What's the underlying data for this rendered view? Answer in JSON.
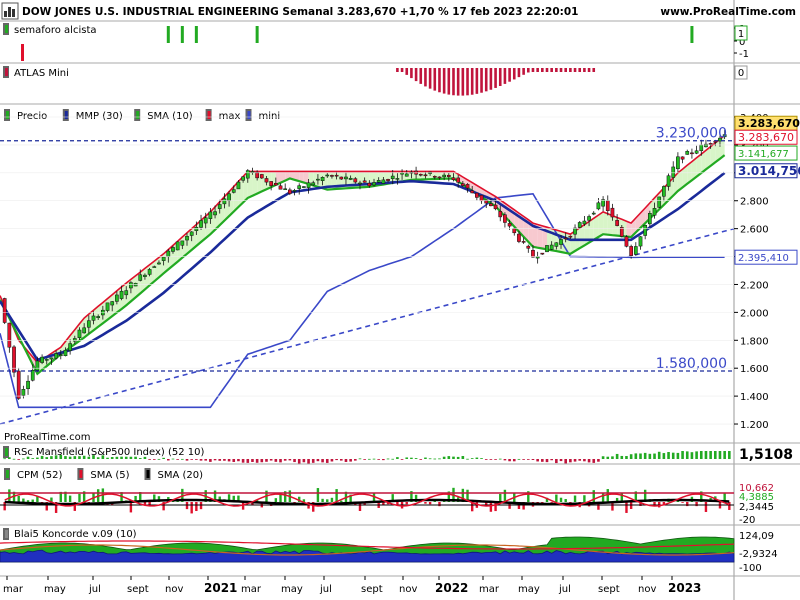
{
  "header": {
    "title": "DOW JONES U.S. INDUSTRIAL ENGINEERING Semanal 3.283,670 +1,70 % 17 feb 2023 22:20:01",
    "site": "www.ProRealTime.com"
  },
  "panels": {
    "semaforo": {
      "legend": "semaforo alcista",
      "ticks": [
        "1",
        "0",
        "-1"
      ],
      "current": "1",
      "color": "#22aa22",
      "signals": [
        "2020-11-02",
        "2020-11-23",
        "2020-12-14",
        "2021-03-15",
        "2022-12-26"
      ]
    },
    "atlas": {
      "legend": "ATLAS Mini",
      "ticks": [
        "0"
      ],
      "color": "#c0143c"
    },
    "price": {
      "legend": [
        "Precio",
        "MMP (30)",
        "SMA (10)",
        "max",
        "mini"
      ],
      "legend_colors": [
        "#22aa22",
        "#1a2a9a",
        "#22aa22",
        "#e0102c",
        "#3a48c8"
      ],
      "levels": {
        "upper": "3.230,000",
        "lower": "1.580,000"
      },
      "badges": {
        "last": "3.283,670",
        "max": "3.283,670",
        "sma": "3.141,677",
        "mmp": "3.014,756",
        "mini": "2.395,410"
      },
      "watermark": "ProRealTime.com"
    },
    "mansfield": {
      "legend": "RSc Mansfield (S&P500 Index) (52 10)",
      "value": "1,5108"
    },
    "cpm": {
      "legend": [
        "CPM (52)",
        "SMA (5)",
        "SMA (20)"
      ],
      "legend_colors": [
        "#22aa22",
        "#e0102c",
        "#000000"
      ],
      "ticks": [
        "10,662",
        "4,3885",
        "2,3445",
        "-20"
      ]
    },
    "koncorde": {
      "legend": "Blai5 Koncorde v.09 (10)",
      "ticks": [
        "124,09",
        "-2,9324",
        "-100"
      ]
    }
  },
  "x_axis": {
    "labels": [
      "mar",
      "may",
      "jul",
      "sept",
      "nov",
      "2021",
      "mar",
      "may",
      "jul",
      "sept",
      "nov",
      "2022",
      "mar",
      "may",
      "jul",
      "sept",
      "nov",
      "2023"
    ]
  },
  "chart_data": {
    "type": "line",
    "title": "DOW JONES U.S. INDUSTRIAL ENGINEERING",
    "xlabel": "",
    "ylabel": "",
    "ylim": [
      1150,
      3400
    ],
    "y_ticks": [
      "3.400",
      "3.200",
      "3.000",
      "2.800",
      "2.600",
      "2.400",
      "2.200",
      "2.000",
      "1.800",
      "1.600",
      "1.400",
      "1.200"
    ],
    "price_dates": [
      "2020-02-24",
      "2020-03-23",
      "2020-04-20",
      "2020-05-25",
      "2020-06-29",
      "2020-08-31",
      "2020-10-26",
      "2021-01-04",
      "2021-03-01",
      "2021-05-03",
      "2021-06-28",
      "2021-08-30",
      "2021-11-01",
      "2022-01-03",
      "2022-03-07",
      "2022-05-02",
      "2022-06-27",
      "2022-08-15",
      "2022-09-26",
      "2022-12-05",
      "2023-02-17"
    ],
    "price_values": [
      2100,
      1400,
      1650,
      1700,
      1900,
      2170,
      2400,
      2700,
      3010,
      2860,
      2980,
      2920,
      3010,
      2960,
      2730,
      2400,
      2560,
      2800,
      2420,
      3100,
      3283.67
    ],
    "series": [
      {
        "name": "max",
        "color": "#e0102c",
        "dates": [
          "2020-02-24",
          "2020-03-23",
          "2020-04-20",
          "2020-05-25",
          "2020-06-29",
          "2020-08-31",
          "2020-10-26",
          "2021-01-04",
          "2021-03-01",
          "2021-05-03",
          "2021-06-28",
          "2021-08-30",
          "2021-11-01",
          "2022-01-03",
          "2022-03-07",
          "2022-05-02",
          "2022-06-27",
          "2022-08-15",
          "2022-09-26",
          "2022-12-05",
          "2023-02-17"
        ],
        "values": [
          2120,
          1800,
          1640,
          1750,
          1960,
          2210,
          2420,
          2720,
          3010,
          3010,
          3010,
          3010,
          3010,
          3010,
          2830,
          2640,
          2560,
          2720,
          2640,
          3000,
          3283.67
        ]
      },
      {
        "name": "mini",
        "color": "#3a48c8",
        "dates": [
          "2020-02-24",
          "2020-03-23",
          "2020-06-29",
          "2020-10-26",
          "2021-01-04",
          "2021-03-01",
          "2021-05-03",
          "2021-06-28",
          "2021-08-30",
          "2021-11-01",
          "2022-01-03",
          "2022-03-07",
          "2022-05-02",
          "2022-06-27",
          "2022-09-26",
          "2023-02-17"
        ],
        "values": [
          1850,
          1320,
          1320,
          1320,
          1320,
          1700,
          1800,
          2150,
          2300,
          2400,
          2600,
          2820,
          2850,
          2400,
          2395,
          2395.41
        ]
      },
      {
        "name": "SMA (10)",
        "color": "#22aa22",
        "dates": [
          "2020-02-24",
          "2020-04-20",
          "2020-05-25",
          "2020-06-29",
          "2020-08-31",
          "2020-10-26",
          "2021-01-04",
          "2021-03-01",
          "2021-05-03",
          "2021-06-28",
          "2021-08-30",
          "2021-11-01",
          "2022-01-03",
          "2022-03-07",
          "2022-05-02",
          "2022-06-27",
          "2022-08-15",
          "2022-09-26",
          "2022-12-05",
          "2023-02-17"
        ],
        "values": [
          2090,
          1560,
          1700,
          1820,
          2050,
          2280,
          2560,
          2820,
          2960,
          2880,
          2900,
          2950,
          2960,
          2760,
          2470,
          2420,
          2560,
          2540,
          2870,
          3141.677
        ]
      },
      {
        "name": "MMP (30)",
        "color": "#1a2a9a",
        "dates": [
          "2020-02-24",
          "2020-04-20",
          "2020-06-29",
          "2020-08-31",
          "2020-10-26",
          "2021-01-04",
          "2021-03-01",
          "2021-05-03",
          "2021-06-28",
          "2021-08-30",
          "2021-11-01",
          "2022-01-03",
          "2022-03-07",
          "2022-05-02",
          "2022-06-27",
          "2022-08-15",
          "2022-09-26",
          "2022-12-05",
          "2023-02-17"
        ],
        "values": [
          2080,
          1660,
          1760,
          1940,
          2140,
          2430,
          2680,
          2860,
          2900,
          2920,
          2940,
          2920,
          2800,
          2620,
          2520,
          2520,
          2520,
          2740,
          3014.756
        ]
      },
      {
        "name": "trendline",
        "color": "#3a48c8",
        "dates": [
          "2020-02-24",
          "2023-02-27"
        ],
        "values": [
          1200,
          2600
        ]
      }
    ]
  }
}
